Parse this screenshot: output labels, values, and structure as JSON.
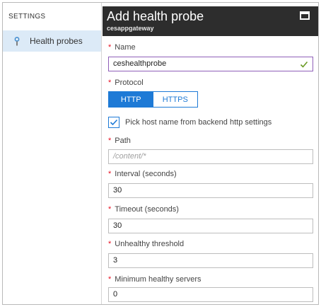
{
  "sidebar": {
    "header": "SETTINGS",
    "items": [
      {
        "label": "Health probes",
        "icon": "health-probe-icon"
      }
    ]
  },
  "blade": {
    "title": "Add health probe",
    "subtitle": "cesappgateway"
  },
  "form": {
    "required_marker": "*",
    "name": {
      "label": "Name",
      "value": "ceshealthprobe",
      "valid": true
    },
    "protocol": {
      "label": "Protocol",
      "options": [
        "HTTP",
        "HTTPS"
      ],
      "selected": "HTTP"
    },
    "pick_host": {
      "label": "Pick host name from backend http settings",
      "checked": true
    },
    "path": {
      "label": "Path",
      "placeholder": "/content/*",
      "value": ""
    },
    "interval": {
      "label": "Interval (seconds)",
      "value": "30"
    },
    "timeout": {
      "label": "Timeout (seconds)",
      "value": "30"
    },
    "unhealthy": {
      "label": "Unhealthy threshold",
      "value": "3"
    },
    "min_servers": {
      "label": "Minimum healthy servers",
      "value": "0"
    }
  },
  "colors": {
    "accent": "#1e7ad6",
    "required": "#e81123",
    "valid_check": "#6a9a23",
    "header_bg": "#2d2d2d",
    "sidebar_selected": "#dceaf7"
  }
}
